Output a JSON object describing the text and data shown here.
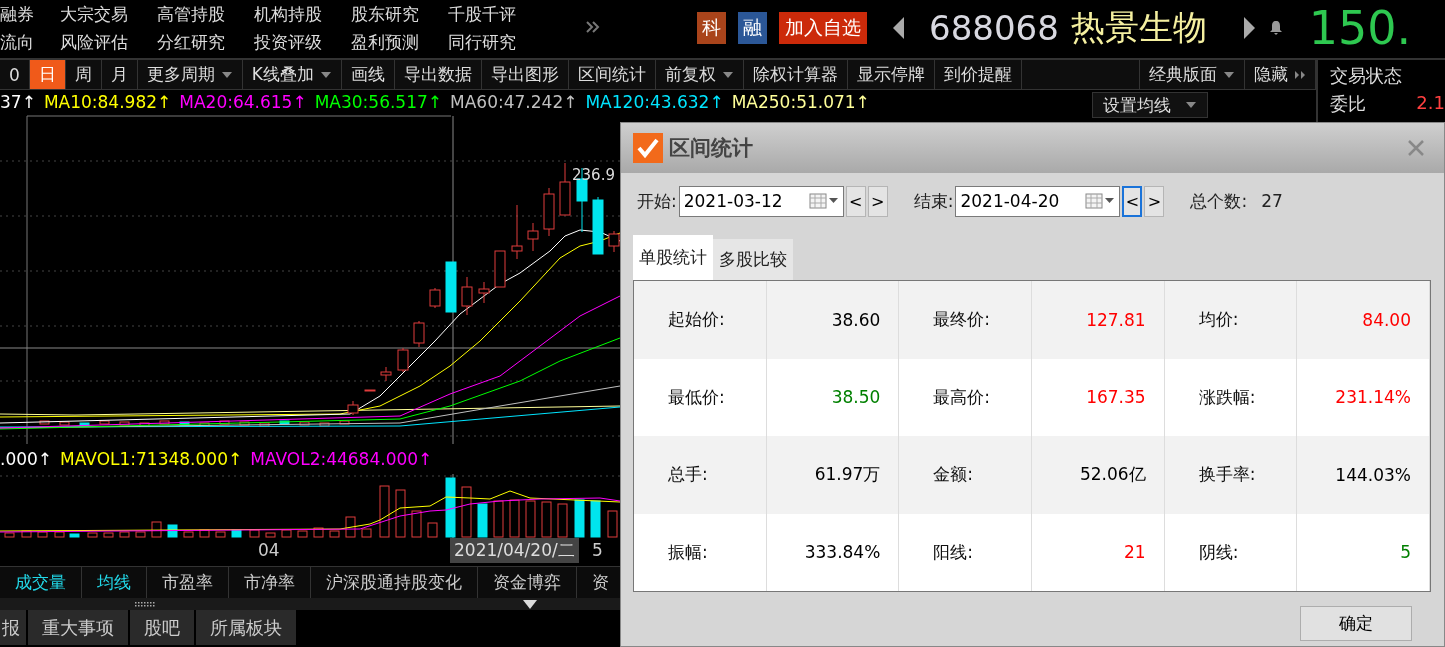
{
  "menu": {
    "rows": [
      [
        "融券",
        "大宗交易",
        "高管持股",
        "机构持股",
        "股东研究",
        "千股千评"
      ],
      [
        "流向",
        "风险评估",
        "分红研究",
        "投资评级",
        "盈利预测",
        "同行研究"
      ]
    ]
  },
  "stock": {
    "badges": [
      {
        "label": "科",
        "color": "#a9441b"
      },
      {
        "label": "融",
        "color": "#2b5797"
      }
    ],
    "watch_button": "加入自选",
    "code": "688068",
    "name": "热景生物",
    "price": "150."
  },
  "toolbar": {
    "periods": [
      {
        "label": "0",
        "selected": false
      },
      {
        "label": "日",
        "selected": true
      },
      {
        "label": "周",
        "selected": false
      },
      {
        "label": "月",
        "selected": false
      }
    ],
    "tools": [
      {
        "label": "更多周期",
        "dropdown": true
      },
      {
        "label": "K线叠加",
        "dropdown": true
      },
      {
        "label": "画线",
        "dropdown": false
      },
      {
        "label": "导出数据",
        "dropdown": false
      },
      {
        "label": "导出图形",
        "dropdown": false
      },
      {
        "label": "区间统计",
        "dropdown": false
      },
      {
        "label": "前复权",
        "dropdown": true
      },
      {
        "label": "除权计算器",
        "dropdown": false
      },
      {
        "label": "显示停牌",
        "dropdown": false
      },
      {
        "label": "到价提醒",
        "dropdown": false
      }
    ],
    "layout_menu": "经典版面",
    "hide_button": "隐藏"
  },
  "side_panel": {
    "title": "交易状态",
    "rows": [
      {
        "label": "委比",
        "value": "2.1"
      }
    ]
  },
  "ma_legend": [
    {
      "text": "37↑",
      "color": "#ffffff"
    },
    {
      "text": "MA10:84.982↑",
      "color": "#ffff00"
    },
    {
      "text": "MA20:64.615↑",
      "color": "#ff00ff"
    },
    {
      "text": "MA30:56.517↑",
      "color": "#00ff00"
    },
    {
      "text": "MA60:47.242↑",
      "color": "#c0c0c0"
    },
    {
      "text": "MA120:43.632↑",
      "color": "#00e5ff"
    },
    {
      "text": "MA250:51.071↑",
      "color": "#ffff99"
    }
  ],
  "ma_settings": "设置均线",
  "chart": {
    "high_label": "236.9"
  },
  "volume_legend": [
    {
      "text": ".000↑",
      "color": "#ffffff"
    },
    {
      "text": "MAVOL1:71348.000↑",
      "color": "#ffff00"
    },
    {
      "text": "MAVOL2:44684.000↑",
      "color": "#ff00ff"
    }
  ],
  "axis": {
    "labels": [
      "04",
      "5"
    ],
    "cursor_date": "2021/04/20/二"
  },
  "indicator_tabs": [
    {
      "label": "成交量",
      "selected": true
    },
    {
      "label": "均线",
      "selected": true
    },
    {
      "label": "市盈率",
      "selected": false
    },
    {
      "label": "市净率",
      "selected": false
    },
    {
      "label": "沪深股通持股变化",
      "selected": false
    },
    {
      "label": "资金博弈",
      "selected": false
    },
    {
      "label": "资",
      "selected": false
    }
  ],
  "bottom_tabs": [
    "报",
    "重大事项",
    "股吧",
    "所属板块"
  ],
  "dialog": {
    "title": "区间统计",
    "start": {
      "label": "开始:",
      "value": "2021-03-12",
      "steps": [
        {
          "label": "<",
          "focused": false
        },
        {
          "label": ">",
          "focused": false
        }
      ]
    },
    "end": {
      "label": "结束:",
      "value": "2021-04-20",
      "steps": [
        {
          "label": "<",
          "focused": true
        },
        {
          "label": ">",
          "focused": false
        }
      ]
    },
    "count": {
      "label": "总个数:",
      "value": "27"
    },
    "tabs": [
      {
        "label": "单股统计",
        "selected": true
      },
      {
        "label": "多股比较",
        "selected": false
      }
    ],
    "stats": [
      [
        {
          "label": "起始价:",
          "value": "38.60",
          "color": "#000000"
        },
        {
          "label": "最终价:",
          "value": "127.81",
          "color": "#ff0000"
        },
        {
          "label": "均价:",
          "value": "84.00",
          "color": "#ff0000"
        }
      ],
      [
        {
          "label": "最低价:",
          "value": "38.50",
          "color": "#008000"
        },
        {
          "label": "最高价:",
          "value": "167.35",
          "color": "#ff0000"
        },
        {
          "label": "涨跌幅:",
          "value": "231.14%",
          "color": "#ff0000"
        }
      ],
      [
        {
          "label": "总手:",
          "value": "61.97万",
          "color": "#000000"
        },
        {
          "label": "金额:",
          "value": "52.06亿",
          "color": "#000000"
        },
        {
          "label": "换手率:",
          "value": "144.03%",
          "color": "#000000"
        }
      ],
      [
        {
          "label": "振幅:",
          "value": "333.84%",
          "color": "#000000"
        },
        {
          "label": "阳线:",
          "value": "21",
          "color": "#ff0000"
        },
        {
          "label": "阴线:",
          "value": "5",
          "color": "#008000"
        }
      ]
    ],
    "ok_button": "确定"
  }
}
